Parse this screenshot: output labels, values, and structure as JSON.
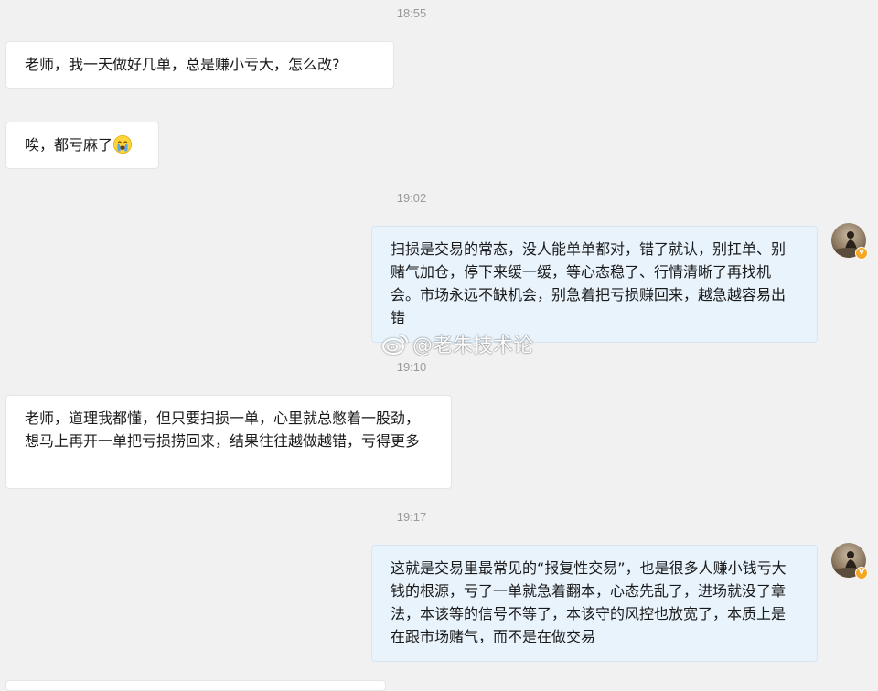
{
  "conversation": {
    "timestamps": [
      "18:55",
      "19:02",
      "19:10",
      "19:17"
    ],
    "messages": [
      {
        "text": "老师，我一天做好几单，总是赚小亏大，怎么改?"
      },
      {
        "text": "唉，都亏麻了",
        "emoji": "crying-face"
      },
      {
        "text": "扫损是交易的常态，没人能单单都对，错了就认，别扛单、别赌气加仓，停下来缓一缓，等心态稳了、行情清晰了再找机会。市场永远不缺机会，别急着把亏损赚回来，越急越容易出错"
      },
      {
        "text": "老师，道理我都懂，但只要扫损一单，心里就总憋着一股劲，想马上再开一单把亏损捞回来，结果往往越做越错，亏得更多"
      },
      {
        "text": "这就是交易里最常见的“报复性交易”，也是很多人赚小钱亏大钱的根源，亏了一单就急着翻本，心态先乱了，进场就没了章法，本该等的信号不等了，本该守的风控也放宽了，本质上是在跟市场赌气，而不是在做交易"
      }
    ]
  },
  "watermark": {
    "text": "@老朱技术论",
    "icon": "weibo-icon"
  },
  "colors": {
    "background": "#f1f1f1",
    "incoming_bubble": "#ffffff",
    "outgoing_bubble": "#e8f3fc",
    "timestamp": "#9a9a9a",
    "verify_badge": "#f5a623"
  }
}
